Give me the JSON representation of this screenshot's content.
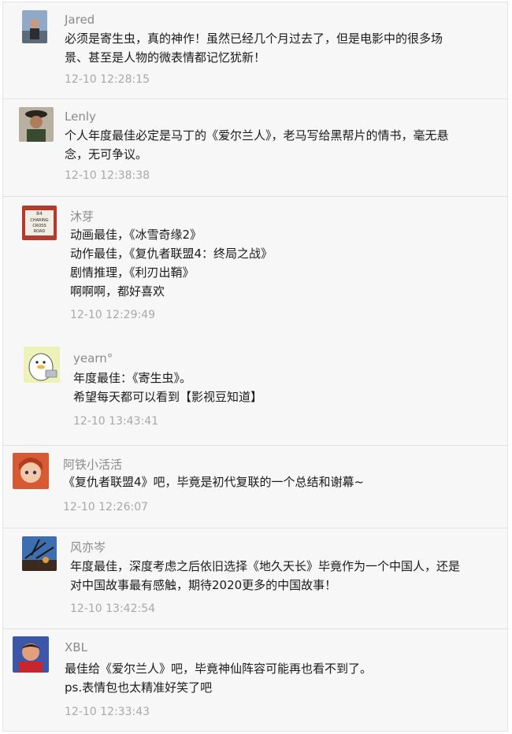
{
  "comments": [
    {
      "user": "Jared",
      "avatar": "avatar-jared",
      "lines": [
        "必须是寄生虫，真的神作！虽然已经几个月过去了，但是电影中的很多场",
        "景、甚至是人物的微表情都记忆犹新！"
      ],
      "time": "12-10 12:28:15"
    },
    {
      "user": "Lenly",
      "avatar": "avatar-lenly",
      "lines": [
        "个人年度最佳必定是马丁的《爱尔兰人》，老马写给黑帮片的情书，毫无悬",
        "念，无可争议。"
      ],
      "time": "12-10 12:38:38"
    },
    {
      "user": "沐芽",
      "avatar": "avatar-sign",
      "avatar_text": [
        "CHARING",
        "CROSS",
        "ROAD"
      ],
      "lines": [
        "动画最佳，《冰雪奇缘2》",
        "动作最佳，《复仇者联盟4：终局之战》",
        "剧情推理，《利刃出鞘》",
        "啊啊啊，都好喜欢"
      ],
      "time": "12-10 12:29:49"
    },
    {
      "user": "yearn°",
      "avatar": "avatar-duck",
      "lines": [
        "年度最佳：《寄生虫》。",
        "希望每天都可以看到【影视豆知道】"
      ],
      "time": "12-10 13:43:41"
    },
    {
      "user": "阿铁小活活",
      "avatar": "avatar-anime-girl",
      "lines": [
        "《复仇者联盟4》吧，毕竟是初代复联的一个总结和谢幕~"
      ],
      "time": "12-10 12:26:07"
    },
    {
      "user": "风亦岑",
      "avatar": "avatar-tree",
      "lines": [
        "年度最佳，深度考虑之后依旧选择《地久天长》毕竟作为一个中国人，还是",
        "对中国故事最有感触，期待2020更多的中国故事！"
      ],
      "time": "12-10 13:42:54"
    },
    {
      "user": "XBL",
      "avatar": "avatar-child",
      "lines": [
        "最佳给《爱尔兰人》吧，毕竟神仙阵容可能再也看不到了。",
        "ps.表情包也太精准好笑了吧"
      ],
      "time": "12-10 12:33:43"
    }
  ]
}
